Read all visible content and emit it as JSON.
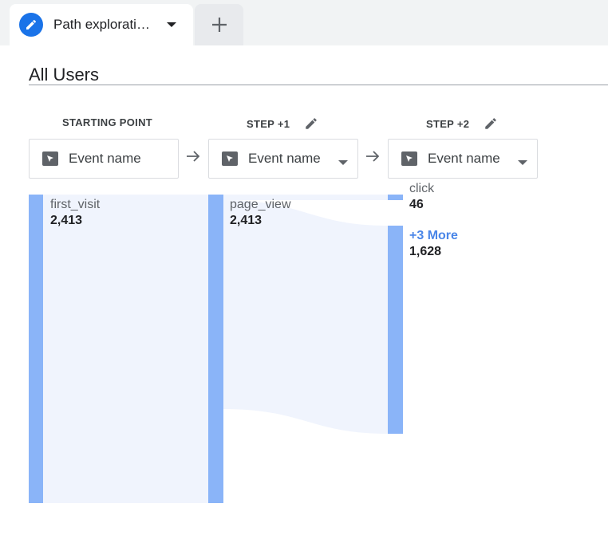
{
  "tab": {
    "title": "Path explorati…",
    "icon": "pencil-icon"
  },
  "add_tab": {
    "icon": "plus-icon"
  },
  "segment": {
    "label": "All Users"
  },
  "steps": [
    {
      "header": "STARTING POINT",
      "dimension": "Event name"
    },
    {
      "header": "STEP +1",
      "dimension": "Event name"
    },
    {
      "header": "STEP +2",
      "dimension": "Event name"
    }
  ],
  "nodes": {
    "first_visit": {
      "name": "first_visit",
      "value": "2,413"
    },
    "page_view": {
      "name": "page_view",
      "value": "2,413"
    },
    "click": {
      "name": "click",
      "value": "46"
    },
    "more": {
      "name": "+3 More",
      "value": "1,628"
    }
  },
  "colors": {
    "accent": "#1a73e8",
    "node": "#8ab4f8",
    "flow": "#f0f4fd",
    "more_link": "#4a86e8"
  }
}
